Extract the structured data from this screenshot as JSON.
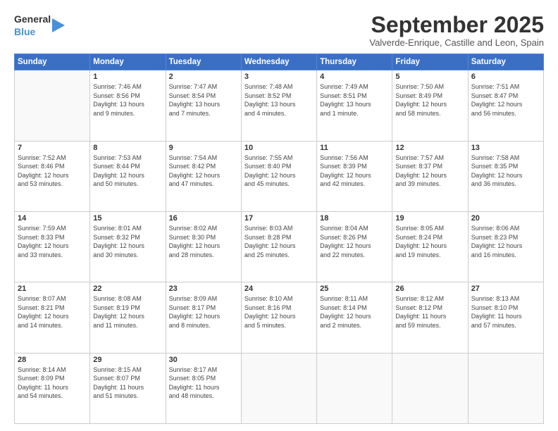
{
  "logo": {
    "line1": "General",
    "line2": "Blue"
  },
  "title": "September 2025",
  "subtitle": "Valverde-Enrique, Castille and Leon, Spain",
  "headers": [
    "Sunday",
    "Monday",
    "Tuesday",
    "Wednesday",
    "Thursday",
    "Friday",
    "Saturday"
  ],
  "weeks": [
    [
      {
        "day": "",
        "detail": ""
      },
      {
        "day": "1",
        "detail": "Sunrise: 7:46 AM\nSunset: 8:56 PM\nDaylight: 13 hours\nand 9 minutes."
      },
      {
        "day": "2",
        "detail": "Sunrise: 7:47 AM\nSunset: 8:54 PM\nDaylight: 13 hours\nand 7 minutes."
      },
      {
        "day": "3",
        "detail": "Sunrise: 7:48 AM\nSunset: 8:52 PM\nDaylight: 13 hours\nand 4 minutes."
      },
      {
        "day": "4",
        "detail": "Sunrise: 7:49 AM\nSunset: 8:51 PM\nDaylight: 13 hours\nand 1 minute."
      },
      {
        "day": "5",
        "detail": "Sunrise: 7:50 AM\nSunset: 8:49 PM\nDaylight: 12 hours\nand 58 minutes."
      },
      {
        "day": "6",
        "detail": "Sunrise: 7:51 AM\nSunset: 8:47 PM\nDaylight: 12 hours\nand 56 minutes."
      }
    ],
    [
      {
        "day": "7",
        "detail": "Sunrise: 7:52 AM\nSunset: 8:46 PM\nDaylight: 12 hours\nand 53 minutes."
      },
      {
        "day": "8",
        "detail": "Sunrise: 7:53 AM\nSunset: 8:44 PM\nDaylight: 12 hours\nand 50 minutes."
      },
      {
        "day": "9",
        "detail": "Sunrise: 7:54 AM\nSunset: 8:42 PM\nDaylight: 12 hours\nand 47 minutes."
      },
      {
        "day": "10",
        "detail": "Sunrise: 7:55 AM\nSunset: 8:40 PM\nDaylight: 12 hours\nand 45 minutes."
      },
      {
        "day": "11",
        "detail": "Sunrise: 7:56 AM\nSunset: 8:39 PM\nDaylight: 12 hours\nand 42 minutes."
      },
      {
        "day": "12",
        "detail": "Sunrise: 7:57 AM\nSunset: 8:37 PM\nDaylight: 12 hours\nand 39 minutes."
      },
      {
        "day": "13",
        "detail": "Sunrise: 7:58 AM\nSunset: 8:35 PM\nDaylight: 12 hours\nand 36 minutes."
      }
    ],
    [
      {
        "day": "14",
        "detail": "Sunrise: 7:59 AM\nSunset: 8:33 PM\nDaylight: 12 hours\nand 33 minutes."
      },
      {
        "day": "15",
        "detail": "Sunrise: 8:01 AM\nSunset: 8:32 PM\nDaylight: 12 hours\nand 30 minutes."
      },
      {
        "day": "16",
        "detail": "Sunrise: 8:02 AM\nSunset: 8:30 PM\nDaylight: 12 hours\nand 28 minutes."
      },
      {
        "day": "17",
        "detail": "Sunrise: 8:03 AM\nSunset: 8:28 PM\nDaylight: 12 hours\nand 25 minutes."
      },
      {
        "day": "18",
        "detail": "Sunrise: 8:04 AM\nSunset: 8:26 PM\nDaylight: 12 hours\nand 22 minutes."
      },
      {
        "day": "19",
        "detail": "Sunrise: 8:05 AM\nSunset: 8:24 PM\nDaylight: 12 hours\nand 19 minutes."
      },
      {
        "day": "20",
        "detail": "Sunrise: 8:06 AM\nSunset: 8:23 PM\nDaylight: 12 hours\nand 16 minutes."
      }
    ],
    [
      {
        "day": "21",
        "detail": "Sunrise: 8:07 AM\nSunset: 8:21 PM\nDaylight: 12 hours\nand 14 minutes."
      },
      {
        "day": "22",
        "detail": "Sunrise: 8:08 AM\nSunset: 8:19 PM\nDaylight: 12 hours\nand 11 minutes."
      },
      {
        "day": "23",
        "detail": "Sunrise: 8:09 AM\nSunset: 8:17 PM\nDaylight: 12 hours\nand 8 minutes."
      },
      {
        "day": "24",
        "detail": "Sunrise: 8:10 AM\nSunset: 8:16 PM\nDaylight: 12 hours\nand 5 minutes."
      },
      {
        "day": "25",
        "detail": "Sunrise: 8:11 AM\nSunset: 8:14 PM\nDaylight: 12 hours\nand 2 minutes."
      },
      {
        "day": "26",
        "detail": "Sunrise: 8:12 AM\nSunset: 8:12 PM\nDaylight: 11 hours\nand 59 minutes."
      },
      {
        "day": "27",
        "detail": "Sunrise: 8:13 AM\nSunset: 8:10 PM\nDaylight: 11 hours\nand 57 minutes."
      }
    ],
    [
      {
        "day": "28",
        "detail": "Sunrise: 8:14 AM\nSunset: 8:09 PM\nDaylight: 11 hours\nand 54 minutes."
      },
      {
        "day": "29",
        "detail": "Sunrise: 8:15 AM\nSunset: 8:07 PM\nDaylight: 11 hours\nand 51 minutes."
      },
      {
        "day": "30",
        "detail": "Sunrise: 8:17 AM\nSunset: 8:05 PM\nDaylight: 11 hours\nand 48 minutes."
      },
      {
        "day": "",
        "detail": ""
      },
      {
        "day": "",
        "detail": ""
      },
      {
        "day": "",
        "detail": ""
      },
      {
        "day": "",
        "detail": ""
      }
    ]
  ]
}
